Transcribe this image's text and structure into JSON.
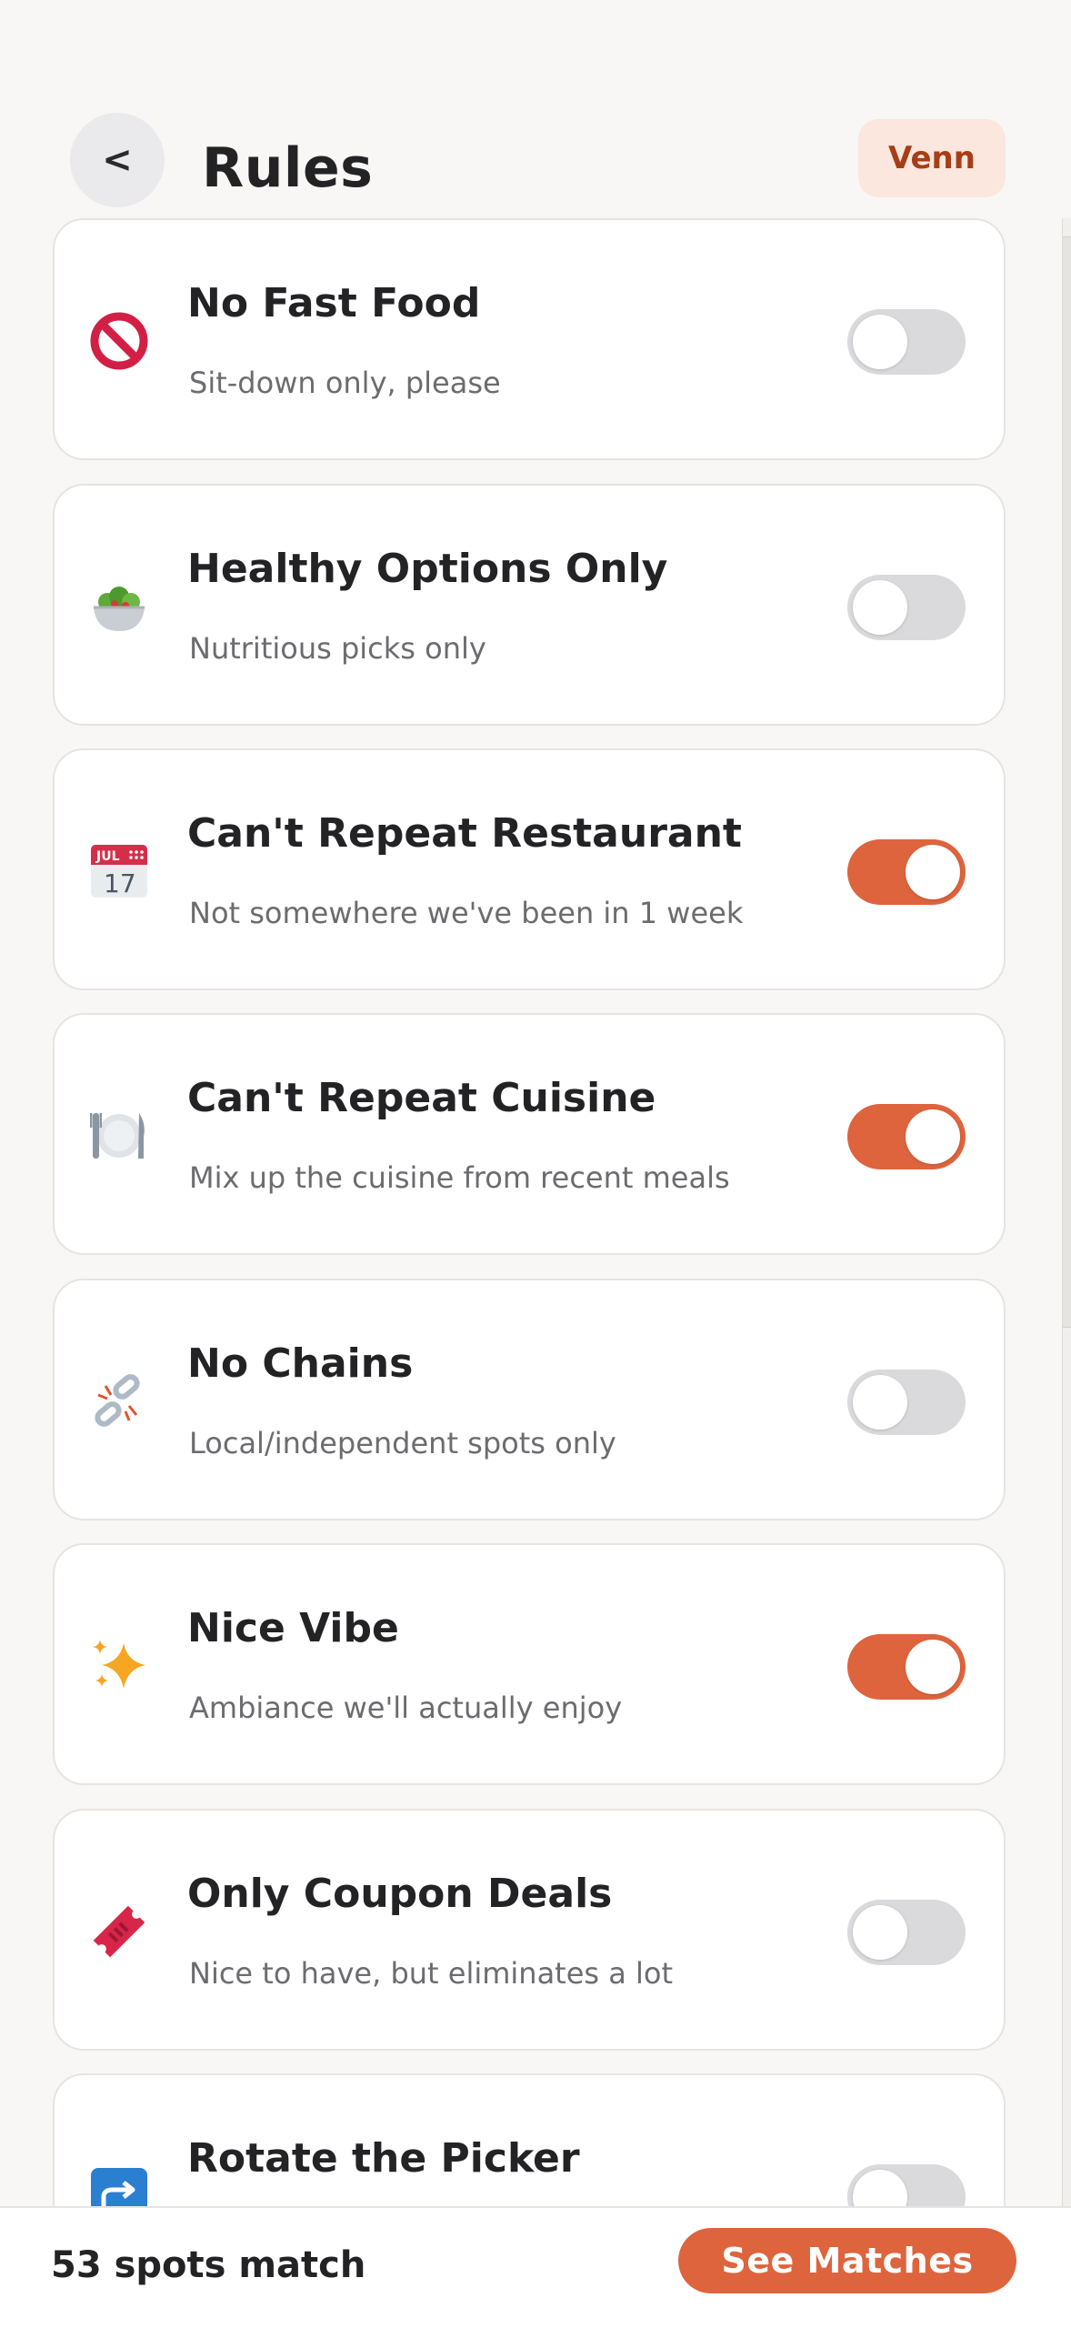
{
  "header": {
    "back_label": "<",
    "title": "Rules",
    "badge": "Venn"
  },
  "rules": [
    {
      "icon": "no-entry-icon",
      "title": "No Fast Food",
      "subtitle": "Sit-down only, please",
      "enabled": false
    },
    {
      "icon": "salad-icon",
      "title": "Healthy Options Only",
      "subtitle": "Nutritious picks only",
      "enabled": false
    },
    {
      "icon": "calendar-icon",
      "title": "Can't Repeat Restaurant",
      "subtitle": "Not somewhere we've been in 1 week",
      "enabled": true,
      "calendar": {
        "month": "JUL",
        "day": "17"
      }
    },
    {
      "icon": "plate-cutlery-icon",
      "title": "Can't Repeat Cuisine",
      "subtitle": "Mix up the cuisine from recent meals",
      "enabled": true
    },
    {
      "icon": "broken-chain-icon",
      "title": "No Chains",
      "subtitle": "Local/independent spots only",
      "enabled": false
    },
    {
      "icon": "sparkles-icon",
      "title": "Nice Vibe",
      "subtitle": "Ambiance we'll actually enjoy",
      "enabled": true
    },
    {
      "icon": "ticket-icon",
      "title": "Only Coupon Deals",
      "subtitle": "Nice to have, but eliminates a lot",
      "enabled": false
    },
    {
      "icon": "share-arrow-icon",
      "title": "Rotate the Picker",
      "subtitle": "",
      "enabled": false
    }
  ],
  "footer": {
    "match_count": "53 spots match",
    "see_matches_label": "See Matches"
  },
  "colors": {
    "accent": "#de643d",
    "toggle_off": "#dadadd",
    "badge_bg": "#fbe7dd",
    "badge_text": "#a63d18"
  }
}
